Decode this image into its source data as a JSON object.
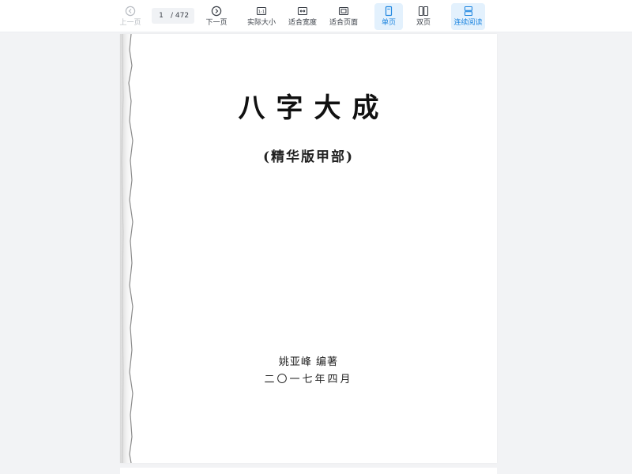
{
  "toolbar": {
    "prev_label": "上一页",
    "current_page": "1",
    "page_separator": "/ 472",
    "next_label": "下一页",
    "actual_size_label": "实际大小",
    "fit_width_label": "适合宽度",
    "fit_page_label": "适合页面",
    "single_page_label": "单页",
    "double_page_label": "双页",
    "continuous_label": "连续阅读"
  },
  "document": {
    "title": "八字大成",
    "subtitle": "(精华版甲部)",
    "author": "姚亚峰 编著",
    "date": "二〇一七年四月"
  },
  "colors": {
    "accent": "#1f86e0",
    "active_bg": "#e3f1fd",
    "viewer_bg": "#f2f3f5"
  }
}
